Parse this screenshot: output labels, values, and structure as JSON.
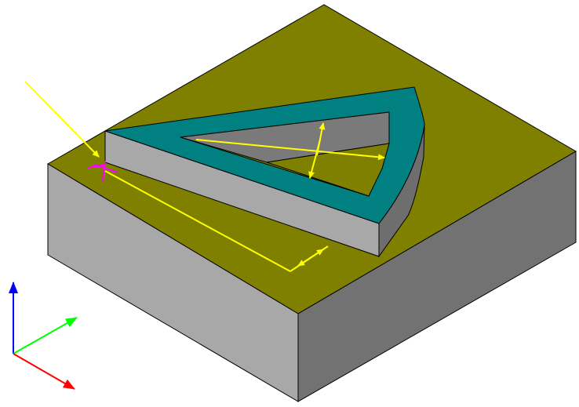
{
  "scene": {
    "background": "#ffffff",
    "colors": {
      "block_top": "#808000",
      "block_left": "#a8a8a8",
      "block_right": "#727272",
      "edge": "#000000",
      "frame_top": "#008080",
      "frame_side": "#a8a8a8",
      "frame_inner_wall": "#7a7a7a",
      "guide": "#ffff00",
      "origin_marker": "#ff00ff"
    }
  },
  "triad": {
    "x_axis_color": "#ff0000",
    "y_axis_color": "#00ff00",
    "z_axis_color": "#0000ff"
  }
}
